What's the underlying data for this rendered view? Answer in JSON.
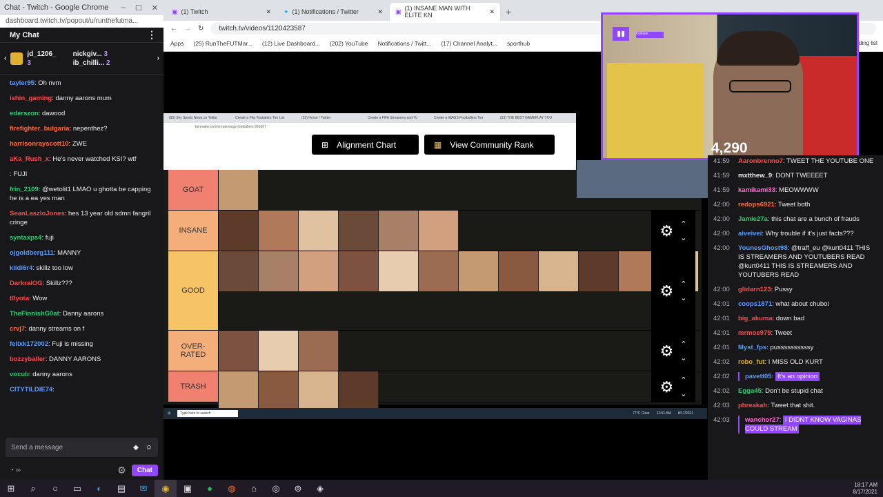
{
  "colors": {
    "twitch_purple": "#9147ff",
    "chat_bg": "#18181b",
    "tier_goat": "#f08070",
    "tier_insane": "#f4ae79",
    "tier_good": "#f6c466",
    "tier_overrated": "#f4ae79",
    "tier_trash": "#f08070"
  },
  "left_chat": {
    "window_title": "Chat - Twitch - Google Chrome",
    "url": "dashboard.twitch.tv/popout/u/runthefutma...",
    "header": "My Chat",
    "subs": [
      {
        "name": "jd_1206_",
        "count": "3"
      },
      {
        "name": "nickgiv...",
        "count": "3"
      },
      {
        "name": "ib_chilli...",
        "count": "2"
      }
    ],
    "messages": [
      {
        "user": "tayler95",
        "color": "#5c9cff",
        "text": ": Oh nvm"
      },
      {
        "user": "ishin_gaming",
        "color": "#ff4a4a",
        "text": ": danny aarons mum"
      },
      {
        "user": "ederszon",
        "color": "#2ecc71",
        "text": ": dawood"
      },
      {
        "user": "firefighter_bulgaria",
        "color": "#ff6a3d",
        "text": ": nepenthez?"
      },
      {
        "user": "harrisonrayscott10",
        "color": "#ff6a3d",
        "text": ": ZWE"
      },
      {
        "user": "aKa_Rush_x",
        "color": "#ff4a4a",
        "text": ": He's never watched KSI? wtf"
      },
      {
        "user": "",
        "color": "#5c9cff",
        "text": ": FUJI"
      },
      {
        "user": "frin_2109",
        "color": "#2ecc71",
        "text": ": @wetolit1 LMAO u ghotta be capping he is a ea yes man"
      },
      {
        "user": "SeanLaszloJones",
        "color": "#ff4a4a",
        "text": ": hes 13 year old sdmn fangril cringe"
      },
      {
        "user": "syntaxps4",
        "color": "#2ecc71",
        "text": ": fuji"
      },
      {
        "user": "ojgoldberg111",
        "color": "#5c9cff",
        "text": ": MANNY"
      },
      {
        "user": "klidi6r4",
        "color": "#5c9cff",
        "text": ": skillz too low"
      },
      {
        "user": "DarkraiOG",
        "color": "#ff4a4a",
        "text": ": Skillz???"
      },
      {
        "user": "t0yota",
        "color": "#ff4a4a",
        "text": ": Wow"
      },
      {
        "user": "TheFinnishG0at",
        "color": "#2ecc71",
        "text": ": Danny aarons"
      },
      {
        "user": "crvj7",
        "color": "#ff6a3d",
        "text": ": danny streams on f"
      },
      {
        "user": "felixk172002",
        "color": "#5c9cff",
        "text": ": Fuji is missing"
      },
      {
        "user": "bozzyballer",
        "color": "#ff4a4a",
        "text": ": DANNY AARONS"
      },
      {
        "user": "vocub",
        "color": "#2ecc71",
        "text": ": danny aarons"
      },
      {
        "user": "CITYTILDIE74",
        "color": "#5c9cff",
        "text": ":"
      }
    ],
    "input_placeholder": "Send a message",
    "points": "∞",
    "chat_button": "Chat"
  },
  "browser": {
    "tabs": [
      {
        "label": "(1) Twitch"
      },
      {
        "label": "(1) Notifications / Twitter"
      },
      {
        "label": "(1) INSANE MAN WITH ELITE KN"
      }
    ],
    "url": "twitch.tv/videos/1120423587",
    "bookmarks": [
      "Apps",
      "(25) RunTheFUTMar...",
      "(12) Live Dashboard...",
      "(202) YouTube",
      "Notifications / Twitt...",
      "(17) Channel Analyt...",
      "sporthub"
    ],
    "side_label": "ding list"
  },
  "inner": {
    "tabs": [
      "(95) Sky Sports News on Twitte",
      "Create a Fifa Youtubers Tier List",
      "(32) Home / Twitter",
      "Create a FIFA Streamers and Yo",
      "Create a WAGS Footballers Tier",
      "(53) THE BEST GAMEPLAY YOU"
    ],
    "url": "tiermaker.com/create/wags-footballers-366657",
    "buttons": {
      "alignment": "Alignment Chart",
      "community": "View Community Rank"
    },
    "tiers": [
      {
        "label": "GOAT",
        "count": 1
      },
      {
        "label": "INSANE",
        "count": 6
      },
      {
        "label": "GOOD",
        "count": 12
      },
      {
        "label": "OVER-\nRATED",
        "count": 3
      },
      {
        "label": "TRASH",
        "count": 4
      }
    ],
    "taskbar": {
      "search": "Type here to search",
      "weather": "77°C Clear",
      "time": "12:51 AM",
      "date": "8/17/2021"
    }
  },
  "webcam": {
    "viewers": "4,290",
    "host_label": "Dotnote"
  },
  "right_chat": {
    "messages": [
      {
        "time": "41:59",
        "user": "Aaronbrenno7",
        "color": "#ff4a4a",
        "text": ": TWEET THE YOUTUBE ONE"
      },
      {
        "time": "41:59",
        "user": "mxtthew_9",
        "color": "#efeff1",
        "text": ": DONT TWEEEET"
      },
      {
        "time": "41:59",
        "user": "kamikami33",
        "color": "#ff6ad5",
        "text": ": MEOWWWW"
      },
      {
        "time": "42:00",
        "user": "redops6921",
        "color": "#ff6a3d",
        "text": ": Tweet both"
      },
      {
        "time": "42:00",
        "user": "Jamie27a",
        "color": "#2ecc71",
        "text": ": this chat are a bunch of frauds"
      },
      {
        "time": "42:00",
        "user": "aiveivei",
        "color": "#5c9cff",
        "text": ": Why trouble if it's just facts???"
      },
      {
        "time": "42:00",
        "user": "YounesGhost98",
        "color": "#5c9cff",
        "text": ": @traff_eu @kurt0411 THIS IS STREAMERS AND YOUTUBERS READ @kurt0411 THIS IS STREAMERS AND YOUTUBERS READ"
      },
      {
        "time": "42:00",
        "user": "glidarn123",
        "color": "#ff4a4a",
        "text": ": Pussy"
      },
      {
        "time": "42:01",
        "user": "coops1871",
        "color": "#5c9cff",
        "text": ": what about chuboi"
      },
      {
        "time": "42:01",
        "user": "big_akuma",
        "color": "#ff4a4a",
        "text": ": down bad"
      },
      {
        "time": "42:01",
        "user": "mrmoe979",
        "color": "#ff4a4a",
        "text": ": Tweet"
      },
      {
        "time": "42:01",
        "user": "Myst_fps",
        "color": "#5c9cff",
        "text": ": pussssssssssy"
      },
      {
        "time": "42:02",
        "user": "robo_fut",
        "color": "#e0b030",
        "text": ": I MISS OLD KURT"
      },
      {
        "time": "42:02",
        "user": "pavett05",
        "color": "#5c9cff",
        "text": ": ",
        "highlight": "It's an opinion"
      },
      {
        "time": "42:02",
        "user": "Egga45",
        "color": "#2ecc71",
        "text": ": Don't be stupid chat"
      },
      {
        "time": "42:03",
        "user": "phreakah",
        "color": "#ff4a4a",
        "text": ": Tweet that shit."
      },
      {
        "time": "42:03",
        "user": "wanchor27",
        "color": "#ff6ad5",
        "text": ": ",
        "highlight": "I DIDNT KNOW VAGINAS COULD STREAM"
      }
    ]
  },
  "taskbar": {
    "time": "18:17 AM",
    "date": "8/17/2021"
  }
}
